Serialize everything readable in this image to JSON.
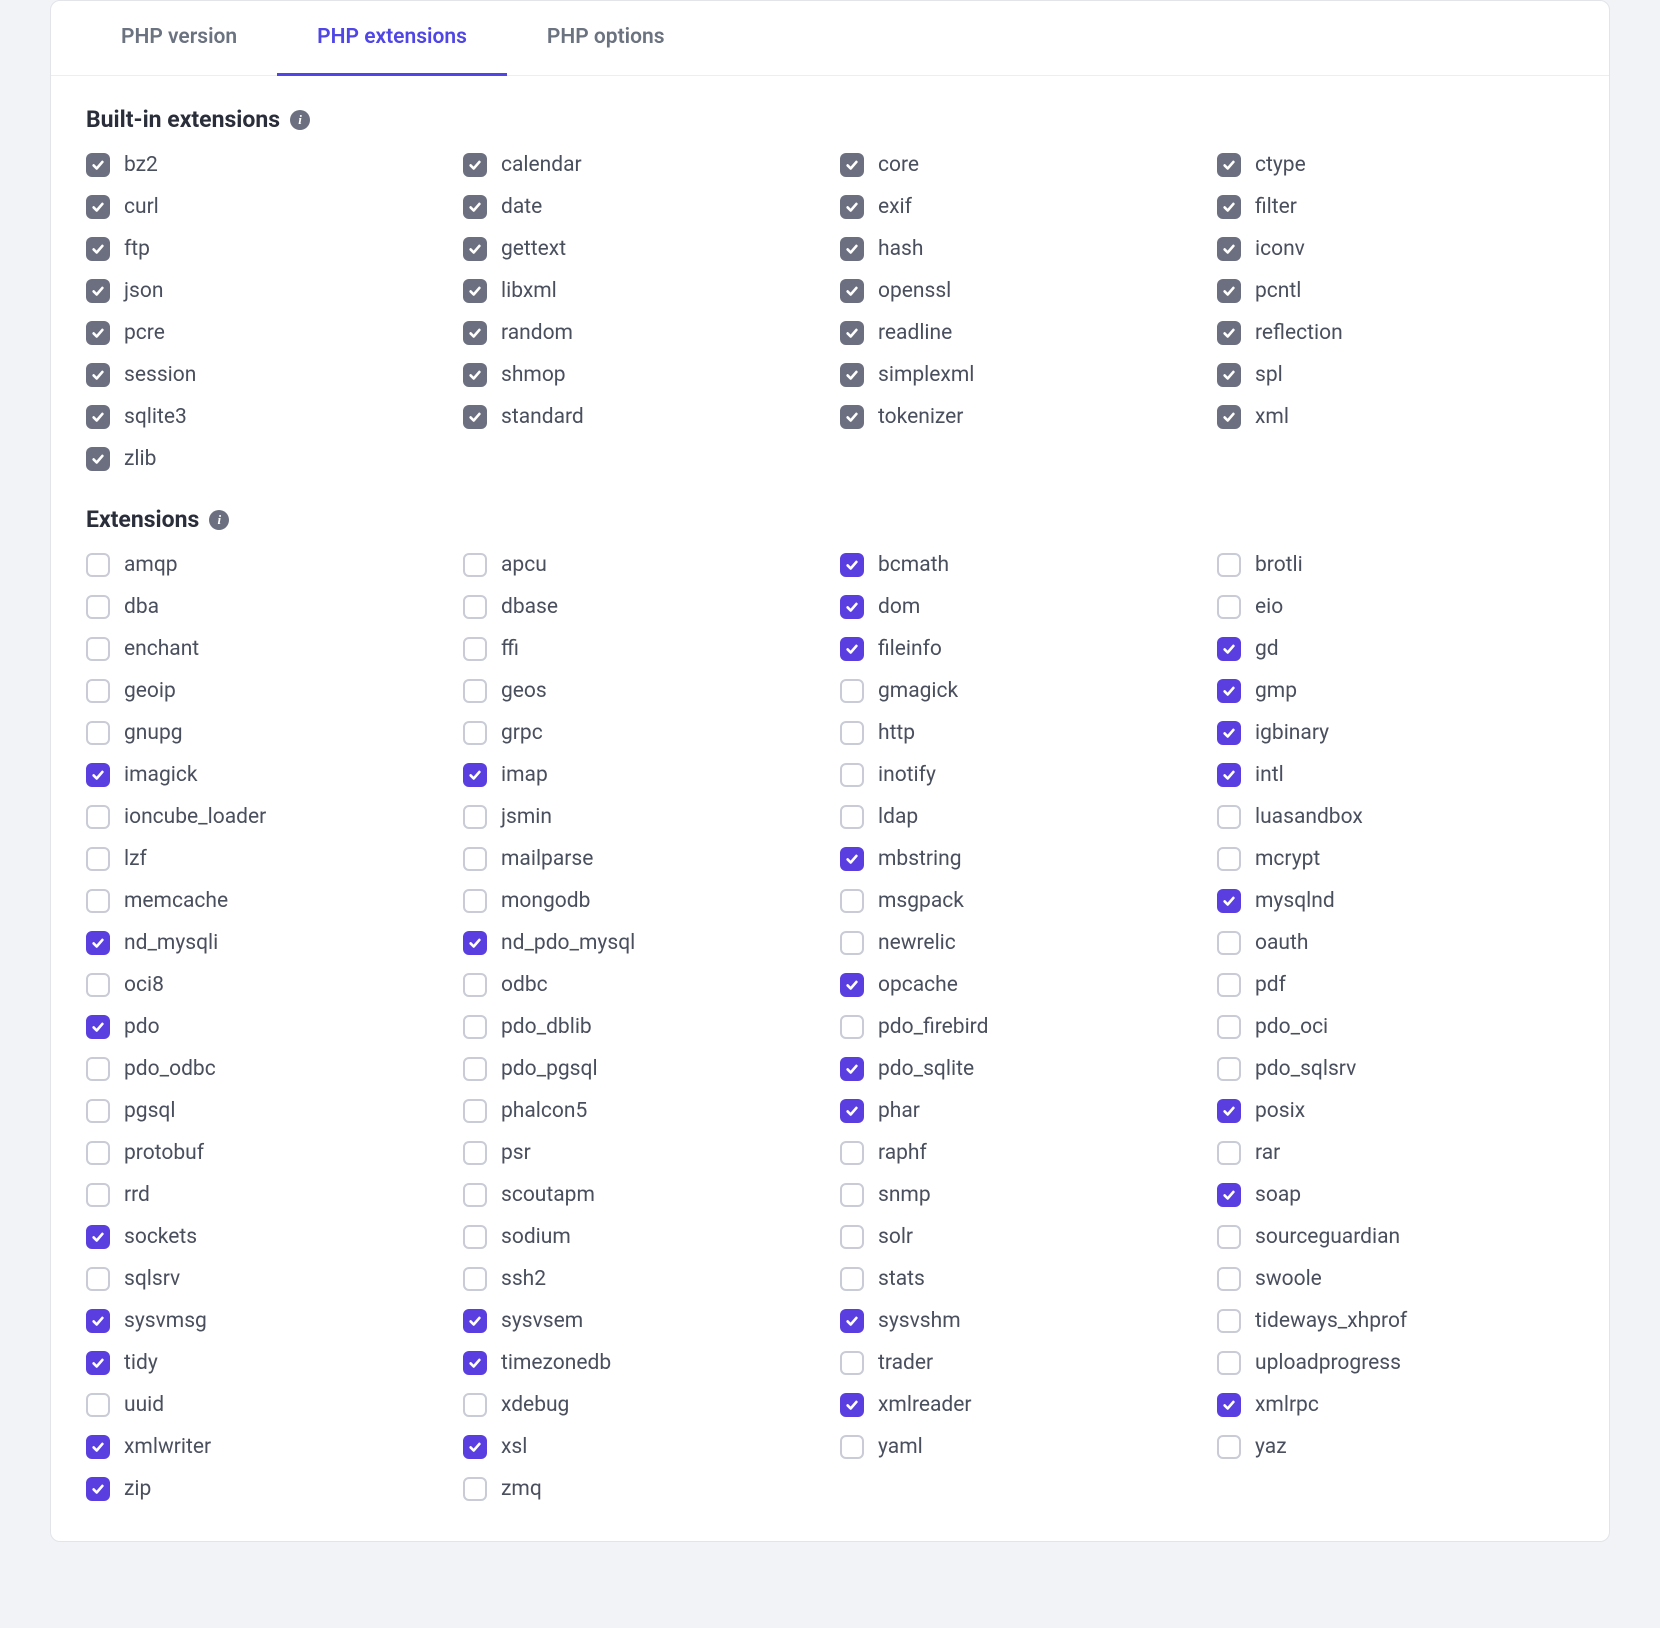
{
  "tabs": [
    {
      "label": "PHP version",
      "active": false
    },
    {
      "label": "PHP extensions",
      "active": true
    },
    {
      "label": "PHP options",
      "active": false
    }
  ],
  "builtin_heading": "Built-in extensions",
  "extensions_heading": "Extensions",
  "builtin": [
    "bz2",
    "calendar",
    "core",
    "ctype",
    "curl",
    "date",
    "exif",
    "filter",
    "ftp",
    "gettext",
    "hash",
    "iconv",
    "json",
    "libxml",
    "openssl",
    "pcntl",
    "pcre",
    "random",
    "readline",
    "reflection",
    "session",
    "shmop",
    "simplexml",
    "spl",
    "sqlite3",
    "standard",
    "tokenizer",
    "xml",
    "zlib"
  ],
  "extensions": [
    {
      "n": "amqp",
      "c": false
    },
    {
      "n": "apcu",
      "c": false
    },
    {
      "n": "bcmath",
      "c": true
    },
    {
      "n": "brotli",
      "c": false
    },
    {
      "n": "dba",
      "c": false
    },
    {
      "n": "dbase",
      "c": false
    },
    {
      "n": "dom",
      "c": true
    },
    {
      "n": "eio",
      "c": false
    },
    {
      "n": "enchant",
      "c": false
    },
    {
      "n": "ffi",
      "c": false
    },
    {
      "n": "fileinfo",
      "c": true
    },
    {
      "n": "gd",
      "c": true
    },
    {
      "n": "geoip",
      "c": false
    },
    {
      "n": "geos",
      "c": false
    },
    {
      "n": "gmagick",
      "c": false
    },
    {
      "n": "gmp",
      "c": true
    },
    {
      "n": "gnupg",
      "c": false
    },
    {
      "n": "grpc",
      "c": false
    },
    {
      "n": "http",
      "c": false
    },
    {
      "n": "igbinary",
      "c": true
    },
    {
      "n": "imagick",
      "c": true
    },
    {
      "n": "imap",
      "c": true
    },
    {
      "n": "inotify",
      "c": false
    },
    {
      "n": "intl",
      "c": true
    },
    {
      "n": "ioncube_loader",
      "c": false
    },
    {
      "n": "jsmin",
      "c": false
    },
    {
      "n": "ldap",
      "c": false
    },
    {
      "n": "luasandbox",
      "c": false
    },
    {
      "n": "lzf",
      "c": false
    },
    {
      "n": "mailparse",
      "c": false
    },
    {
      "n": "mbstring",
      "c": true
    },
    {
      "n": "mcrypt",
      "c": false
    },
    {
      "n": "memcache",
      "c": false
    },
    {
      "n": "mongodb",
      "c": false
    },
    {
      "n": "msgpack",
      "c": false
    },
    {
      "n": "mysqlnd",
      "c": true
    },
    {
      "n": "nd_mysqli",
      "c": true
    },
    {
      "n": "nd_pdo_mysql",
      "c": true
    },
    {
      "n": "newrelic",
      "c": false
    },
    {
      "n": "oauth",
      "c": false
    },
    {
      "n": "oci8",
      "c": false
    },
    {
      "n": "odbc",
      "c": false
    },
    {
      "n": "opcache",
      "c": true
    },
    {
      "n": "pdf",
      "c": false
    },
    {
      "n": "pdo",
      "c": true
    },
    {
      "n": "pdo_dblib",
      "c": false
    },
    {
      "n": "pdo_firebird",
      "c": false
    },
    {
      "n": "pdo_oci",
      "c": false
    },
    {
      "n": "pdo_odbc",
      "c": false
    },
    {
      "n": "pdo_pgsql",
      "c": false
    },
    {
      "n": "pdo_sqlite",
      "c": true
    },
    {
      "n": "pdo_sqlsrv",
      "c": false
    },
    {
      "n": "pgsql",
      "c": false
    },
    {
      "n": "phalcon5",
      "c": false
    },
    {
      "n": "phar",
      "c": true
    },
    {
      "n": "posix",
      "c": true
    },
    {
      "n": "protobuf",
      "c": false
    },
    {
      "n": "psr",
      "c": false
    },
    {
      "n": "raphf",
      "c": false
    },
    {
      "n": "rar",
      "c": false
    },
    {
      "n": "rrd",
      "c": false
    },
    {
      "n": "scoutapm",
      "c": false
    },
    {
      "n": "snmp",
      "c": false
    },
    {
      "n": "soap",
      "c": true
    },
    {
      "n": "sockets",
      "c": true
    },
    {
      "n": "sodium",
      "c": false
    },
    {
      "n": "solr",
      "c": false
    },
    {
      "n": "sourceguardian",
      "c": false
    },
    {
      "n": "sqlsrv",
      "c": false
    },
    {
      "n": "ssh2",
      "c": false
    },
    {
      "n": "stats",
      "c": false
    },
    {
      "n": "swoole",
      "c": false
    },
    {
      "n": "sysvmsg",
      "c": true
    },
    {
      "n": "sysvsem",
      "c": true
    },
    {
      "n": "sysvshm",
      "c": true
    },
    {
      "n": "tideways_xhprof",
      "c": false
    },
    {
      "n": "tidy",
      "c": true
    },
    {
      "n": "timezonedb",
      "c": true
    },
    {
      "n": "trader",
      "c": false
    },
    {
      "n": "uploadprogress",
      "c": false
    },
    {
      "n": "uuid",
      "c": false
    },
    {
      "n": "xdebug",
      "c": false
    },
    {
      "n": "xmlreader",
      "c": true
    },
    {
      "n": "xmlrpc",
      "c": true
    },
    {
      "n": "xmlwriter",
      "c": true
    },
    {
      "n": "xsl",
      "c": true
    },
    {
      "n": "yaml",
      "c": false
    },
    {
      "n": "yaz",
      "c": false
    },
    {
      "n": "zip",
      "c": true
    },
    {
      "n": "zmq",
      "c": false
    }
  ]
}
